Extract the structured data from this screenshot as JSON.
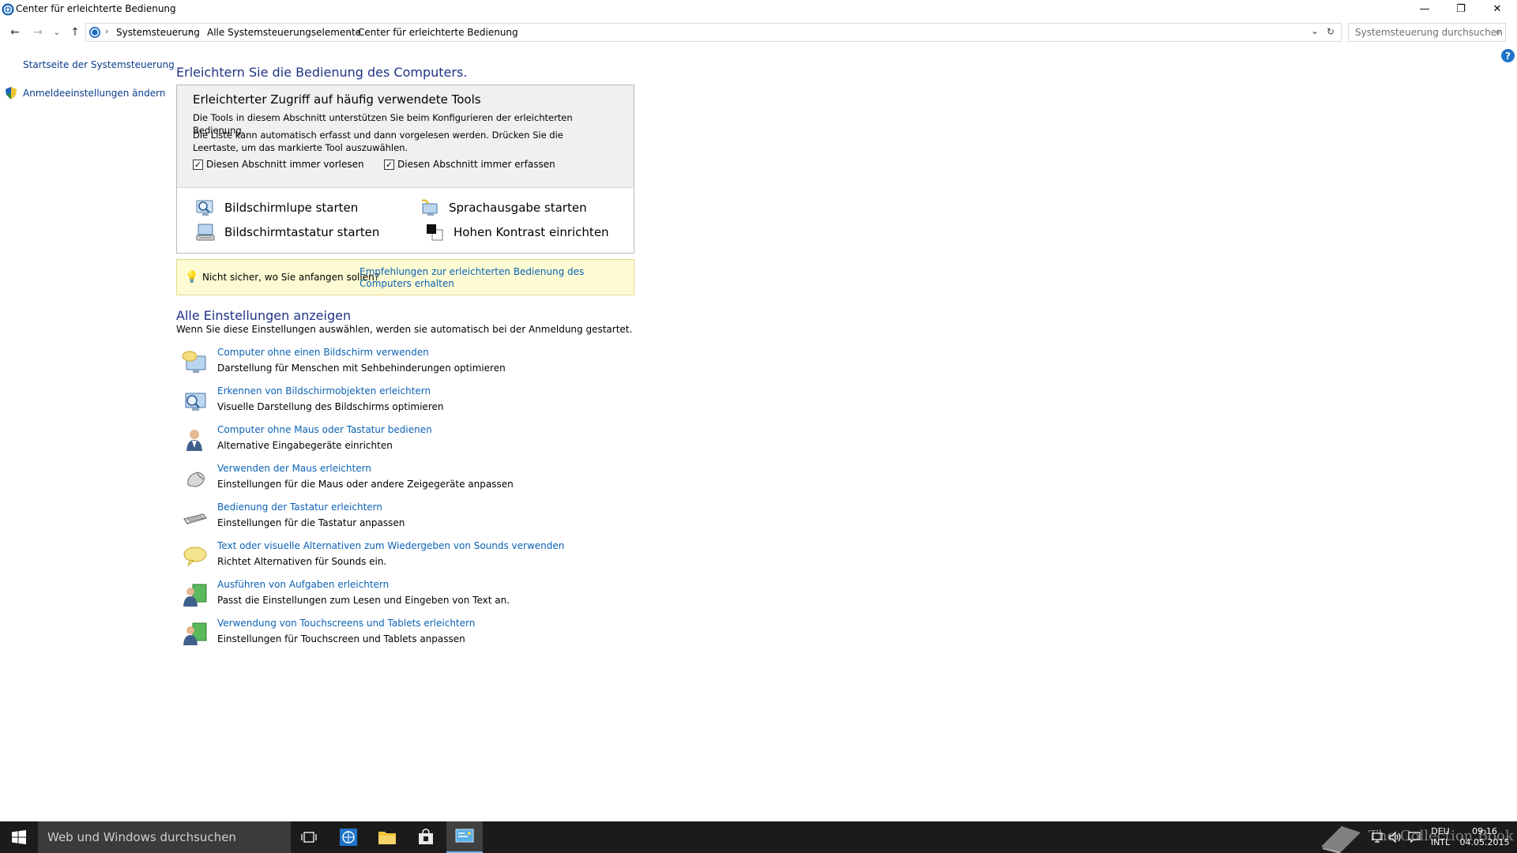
{
  "window": {
    "title": "Center für erleichterte Bedienung",
    "minimize": "—",
    "restore": "❐",
    "close": "✕"
  },
  "nav": {
    "back": "←",
    "forward": "→",
    "recent": "⌄",
    "up": "↑",
    "breadcrumbs": [
      "Systemsteuerung",
      "Alle Systemsteuerungselemente",
      "Center für erleichterte Bedienung"
    ],
    "separator": "›",
    "dropdown": "⌄",
    "refresh": "↻",
    "search_placeholder": "Systemsteuerung durchsuchen",
    "search_icon": "⌕"
  },
  "sidebar": {
    "home": "Startseite der Systemsteuerung",
    "signin": "Anmeldeeinstellungen ändern"
  },
  "help": "?",
  "main": {
    "heading": "Erleichtern Sie die Bedienung des Computers.",
    "tools": {
      "title": "Erleichterter Zugriff auf häufig verwendete Tools",
      "line1": "Die Tools in diesem Abschnitt unterstützen Sie beim Konfigurieren der erleichterten Bedienung.",
      "line2": "Die Liste kann automatisch erfasst und dann vorgelesen werden. Drücken Sie die Leertaste, um das markierte Tool auszuwählen.",
      "cb_read": "Diesen Abschnitt immer vorlesen",
      "cb_scan": "Diesen Abschnitt immer erfassen",
      "cb_read_checked": true,
      "cb_scan_checked": true,
      "magnifier": "Bildschirmlupe starten",
      "narrator": "Sprachausgabe starten",
      "osk": "Bildschirmtastatur starten",
      "contrast": "Hohen Kontrast einrichten"
    },
    "tip": {
      "question": "Nicht sicher, wo Sie anfangen sollen?",
      "link": "Empfehlungen zur erleichterten Bedienung des Computers erhalten"
    },
    "all_heading": "Alle Einstellungen anzeigen",
    "all_sub": "Wenn Sie diese Einstellungen auswählen, werden sie automatisch bei der Anmeldung gestartet.",
    "items": [
      {
        "link": "Computer ohne einen Bildschirm verwenden",
        "desc": "Darstellung für Menschen mit Sehbehinderungen optimieren"
      },
      {
        "link": "Erkennen von Bildschirmobjekten erleichtern",
        "desc": "Visuelle Darstellung des Bildschirms optimieren"
      },
      {
        "link": "Computer ohne Maus oder Tastatur bedienen",
        "desc": "Alternative Eingabegeräte einrichten"
      },
      {
        "link": "Verwenden der Maus erleichtern",
        "desc": "Einstellungen für die Maus oder andere Zeigegeräte anpassen"
      },
      {
        "link": "Bedienung der Tastatur erleichtern",
        "desc": "Einstellungen für die Tastatur anpassen"
      },
      {
        "link": "Text oder visuelle Alternativen zum Wiedergeben von Sounds verwenden",
        "desc": "Richtet Alternativen für Sounds ein."
      },
      {
        "link": "Ausführen von Aufgaben erleichtern",
        "desc": "Passt die Einstellungen zum Lesen und Eingeben von Text an."
      },
      {
        "link": "Verwendung von Touchscreens und Tablets erleichtern",
        "desc": "Einstellungen für Touchscreen und Tablets anpassen"
      }
    ]
  },
  "taskbar": {
    "search_placeholder": "Web und Windows durchsuchen",
    "lang_top": "DEU",
    "lang_bottom": "INTL",
    "time": "09:16",
    "date": "04.05.2015",
    "watermark": "The Collection Book"
  }
}
